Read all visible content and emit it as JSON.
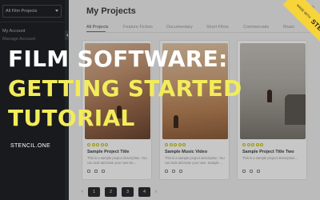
{
  "sidebar": {
    "project_select": "All Film Projects",
    "my_account": "My Account",
    "manage_account": "Manage Account"
  },
  "main": {
    "title": "My Projects",
    "tabs": [
      {
        "label": "All Projects",
        "active": true
      },
      {
        "label": "Feature Fiction",
        "active": false
      },
      {
        "label": "Documentary",
        "active": false
      },
      {
        "label": "Short Films",
        "active": false
      },
      {
        "label": "Commercials",
        "active": false
      },
      {
        "label": "Music",
        "active": false
      }
    ],
    "cards": [
      {
        "title": "Sample Project Title",
        "description": "This is a sample project description. You can look at/create your own Ne...",
        "rating_dots": 5
      },
      {
        "title": "Sample Music Video",
        "description": "This is a sample project description. You can look at/create your own. Sample ...",
        "rating_dots": 5
      },
      {
        "title": "Sample Project Title Two",
        "description": "This is a sample project description...",
        "rating_dots": 5
      }
    ],
    "pagination": {
      "pages": [
        "1",
        "2",
        "3",
        "4"
      ],
      "prev": "‹",
      "next": "›"
    }
  },
  "overlay": {
    "line1": "FILM SOFTWARE:",
    "line2": "GETTING STARTED",
    "line3": "TUTORIAL",
    "brand": "STENCIL.ONE"
  },
  "ribbon": {
    "made_with": "MADE WITH",
    "brand": "STENCIL.ONE"
  },
  "colors": {
    "accent_yellow": "#f2ec5b",
    "ribbon_yellow": "#f6d43a",
    "sidebar_bg": "#1f2226",
    "main_bg": "#f0f0f0",
    "rating_dot": "#c1c700"
  }
}
